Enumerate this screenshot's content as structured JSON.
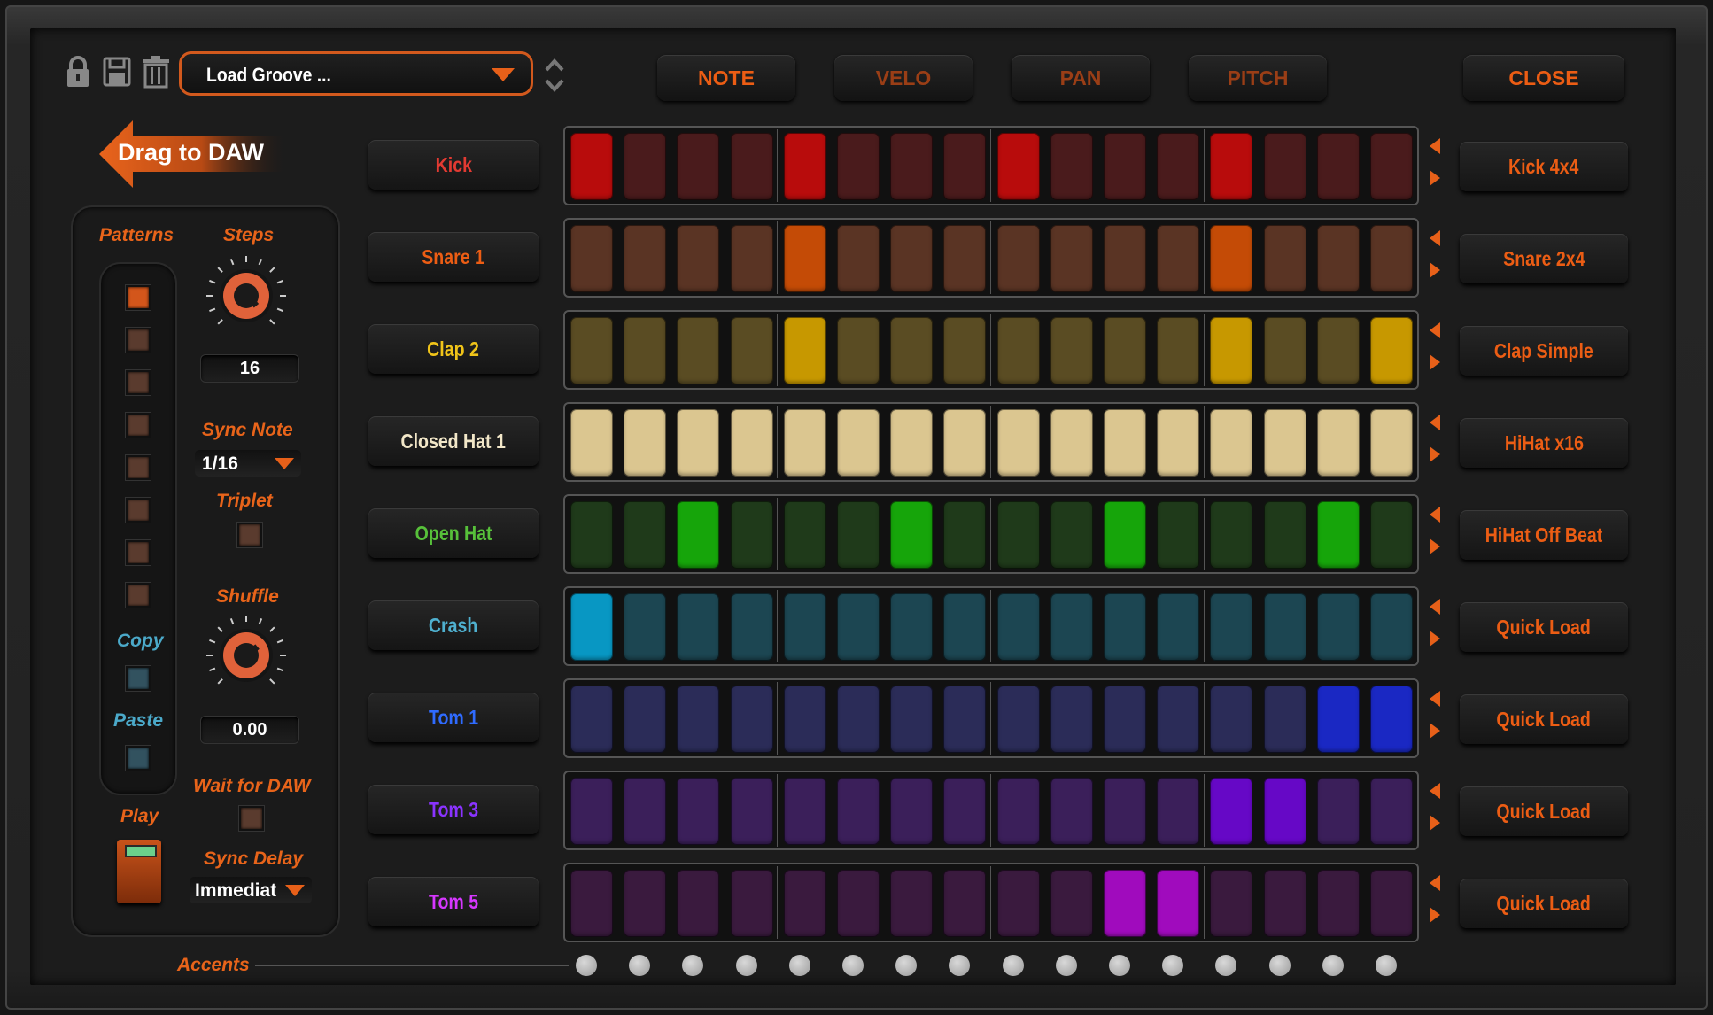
{
  "toolbar": {
    "icons": [
      "lock-icon",
      "save-icon",
      "trash-icon"
    ],
    "preset_label": "Load Groove ...",
    "modes": [
      {
        "label": "NOTE",
        "active": true
      },
      {
        "label": "VELO",
        "active": false
      },
      {
        "label": "PAN",
        "active": false
      },
      {
        "label": "PITCH",
        "active": false
      }
    ],
    "close_label": "CLOSE"
  },
  "drag_label": "Drag to DAW",
  "left_panel": {
    "patterns_label": "Patterns",
    "pattern_selected": 1,
    "pattern_count": 8,
    "copy_label": "Copy",
    "paste_label": "Paste",
    "play_label": "Play",
    "steps_label": "Steps",
    "steps_value": "16",
    "sync_note_label": "Sync Note",
    "sync_note_value": "1/16",
    "triplet_label": "Triplet",
    "shuffle_label": "Shuffle",
    "shuffle_value": "0.00",
    "wait_label": "Wait for DAW",
    "sync_delay_label": "Sync Delay",
    "sync_delay_value": "Immediat"
  },
  "tracks": [
    {
      "name": "Kick",
      "color": "#e23a32",
      "on": "#b80c0c",
      "off": "#4a1b1c",
      "preset": "Kick 4x4",
      "steps": [
        1,
        0,
        0,
        0,
        1,
        0,
        0,
        0,
        1,
        0,
        0,
        0,
        1,
        0,
        0,
        0
      ]
    },
    {
      "name": "Snare 1",
      "color": "#ec5d14",
      "on": "#c44b06",
      "off": "#5a3424",
      "preset": "Snare 2x4",
      "steps": [
        0,
        0,
        0,
        0,
        1,
        0,
        0,
        0,
        0,
        0,
        0,
        0,
        1,
        0,
        0,
        0
      ]
    },
    {
      "name": "Clap 2",
      "color": "#f0c419",
      "on": "#c79800",
      "off": "#5a4c23",
      "preset": "Clap Simple",
      "steps": [
        0,
        0,
        0,
        0,
        1,
        0,
        0,
        0,
        0,
        0,
        0,
        0,
        1,
        0,
        0,
        1
      ]
    },
    {
      "name": "Closed Hat 1",
      "color": "#f2e7c8",
      "on": "#dbc690",
      "off": "#dbc690",
      "preset": "HiHat x16",
      "steps": [
        1,
        1,
        1,
        1,
        1,
        1,
        1,
        1,
        1,
        1,
        1,
        1,
        1,
        1,
        1,
        1
      ]
    },
    {
      "name": "Open Hat",
      "color": "#57c13a",
      "on": "#16a50a",
      "off": "#1f3a1a",
      "preset": "HiHat Off Beat",
      "steps": [
        0,
        0,
        1,
        0,
        0,
        0,
        1,
        0,
        0,
        0,
        1,
        0,
        0,
        0,
        1,
        0
      ]
    },
    {
      "name": "Crash",
      "color": "#4fb0cf",
      "on": "#0897c3",
      "off": "#1c4652",
      "preset": "Quick Load",
      "steps": [
        1,
        0,
        0,
        0,
        0,
        0,
        0,
        0,
        0,
        0,
        0,
        0,
        0,
        0,
        0,
        0
      ]
    },
    {
      "name": "Tom 1",
      "color": "#2f6bff",
      "on": "#1a28c3",
      "off": "#2b2c58",
      "preset": "Quick Load",
      "steps": [
        0,
        0,
        0,
        0,
        0,
        0,
        0,
        0,
        0,
        0,
        0,
        0,
        0,
        0,
        1,
        1
      ]
    },
    {
      "name": "Tom 3",
      "color": "#8a33ff",
      "on": "#6608c6",
      "off": "#3b1f5a",
      "preset": "Quick Load",
      "steps": [
        0,
        0,
        0,
        0,
        0,
        0,
        0,
        0,
        0,
        0,
        0,
        0,
        1,
        1,
        0,
        0
      ]
    },
    {
      "name": "Tom 5",
      "color": "#d637ff",
      "on": "#a00bbd",
      "off": "#3a1a3e",
      "preset": "Quick Load",
      "steps": [
        0,
        0,
        0,
        0,
        0,
        0,
        0,
        0,
        0,
        0,
        1,
        1,
        0,
        0,
        0,
        0
      ]
    }
  ],
  "accents_label": "Accents",
  "accent_count": 16
}
